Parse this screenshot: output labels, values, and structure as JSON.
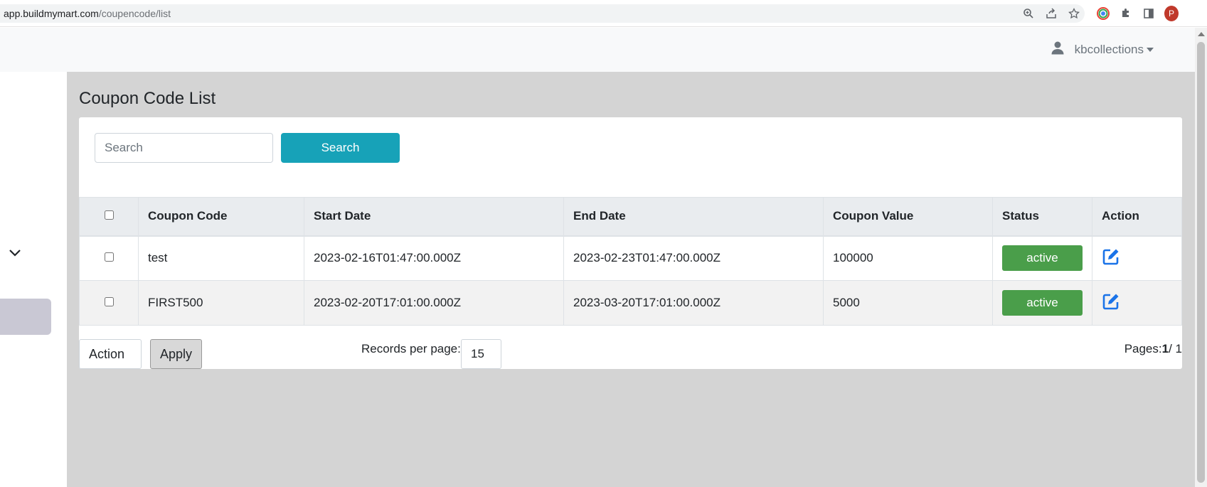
{
  "browser": {
    "url_domain": "app.buildmymart.com",
    "url_path": "/coupencode/list",
    "profile_initial": "P"
  },
  "header": {
    "username": "kbcollections"
  },
  "page": {
    "title": "Coupon Code List"
  },
  "search": {
    "placeholder": "Search",
    "value": "",
    "button_label": "Search"
  },
  "table": {
    "columns": [
      "Coupon Code",
      "Start Date",
      "End Date",
      "Coupon Value",
      "Status",
      "Action"
    ],
    "rows": [
      {
        "code": "test",
        "start": "2023-02-16T01:47:00.000Z",
        "end": "2023-02-23T01:47:00.000Z",
        "value": "100000",
        "status": "active"
      },
      {
        "code": "FIRST500",
        "start": "2023-02-20T17:01:00.000Z",
        "end": "2023-03-20T17:01:00.000Z",
        "value": "5000",
        "status": "active"
      }
    ]
  },
  "footer": {
    "action_label": "Action",
    "apply_label": "Apply",
    "records_per_page_label": "Records per page:",
    "records_per_page_value": "15",
    "pages_label": "Pages:",
    "current_page": "1",
    "total_pages": "/ 1"
  },
  "colors": {
    "accent": "#17a2b8",
    "status_active": "#4a9e4a",
    "edit_icon": "#1a73e8"
  }
}
